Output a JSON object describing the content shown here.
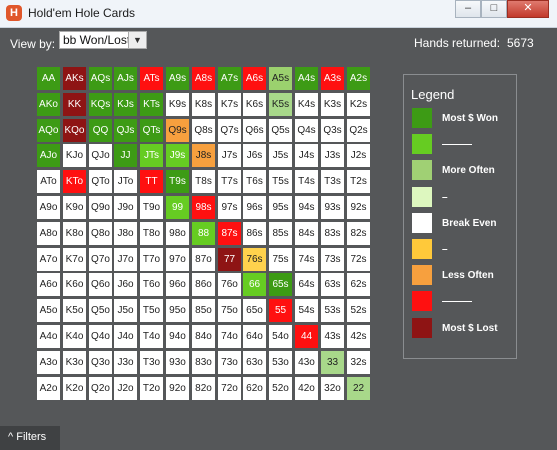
{
  "window": {
    "title": "Hold'em Hole Cards",
    "app_icon_glyph": "H",
    "controls": {
      "minimize": "–",
      "maximize": "□",
      "close": "✕"
    }
  },
  "toolbar": {
    "view_by_label": "View by:",
    "view_by_value": "bb Won/Lost",
    "hands_label": "Hands returned:",
    "hands_value": "5673"
  },
  "grid": {
    "rows": [
      [
        "AA",
        "AKs",
        "AQs",
        "AJs",
        "ATs",
        "A9s",
        "A8s",
        "A7s",
        "A6s",
        "A5s",
        "A4s",
        "A3s",
        "A2s"
      ],
      [
        "AKo",
        "KK",
        "KQs",
        "KJs",
        "KTs",
        "K9s",
        "K8s",
        "K7s",
        "K6s",
        "K5s",
        "K4s",
        "K3s",
        "K2s"
      ],
      [
        "AQo",
        "KQo",
        "QQ",
        "QJs",
        "QTs",
        "Q9s",
        "Q8s",
        "Q7s",
        "Q6s",
        "Q5s",
        "Q4s",
        "Q3s",
        "Q2s"
      ],
      [
        "AJo",
        "KJo",
        "QJo",
        "JJ",
        "JTs",
        "J9s",
        "J8s",
        "J7s",
        "J6s",
        "J5s",
        "J4s",
        "J3s",
        "J2s"
      ],
      [
        "ATo",
        "KTo",
        "QTo",
        "JTo",
        "TT",
        "T9s",
        "T8s",
        "T7s",
        "T6s",
        "T5s",
        "T4s",
        "T3s",
        "T2s"
      ],
      [
        "A9o",
        "K9o",
        "Q9o",
        "J9o",
        "T9o",
        "99",
        "98s",
        "97s",
        "96s",
        "95s",
        "94s",
        "93s",
        "92s"
      ],
      [
        "A8o",
        "K8o",
        "Q8o",
        "J8o",
        "T8o",
        "98o",
        "88",
        "87s",
        "86s",
        "85s",
        "84s",
        "83s",
        "82s"
      ],
      [
        "A7o",
        "K7o",
        "Q7o",
        "J7o",
        "T7o",
        "97o",
        "87o",
        "77",
        "76s",
        "75s",
        "74s",
        "73s",
        "72s"
      ],
      [
        "A6o",
        "K6o",
        "Q6o",
        "J6o",
        "T6o",
        "96o",
        "86o",
        "76o",
        "66",
        "65s",
        "64s",
        "63s",
        "62s"
      ],
      [
        "A5o",
        "K5o",
        "Q5o",
        "J5o",
        "T5o",
        "95o",
        "85o",
        "75o",
        "65o",
        "55",
        "54s",
        "53s",
        "52s"
      ],
      [
        "A4o",
        "K4o",
        "Q4o",
        "J4o",
        "T4o",
        "94o",
        "84o",
        "74o",
        "64o",
        "54o",
        "44",
        "43s",
        "42s"
      ],
      [
        "A3o",
        "K3o",
        "Q3o",
        "J3o",
        "T3o",
        "93o",
        "83o",
        "73o",
        "63o",
        "53o",
        "43o",
        "33",
        "32s"
      ],
      [
        "A2o",
        "K2o",
        "Q2o",
        "J2o",
        "T2o",
        "92o",
        "82o",
        "72o",
        "62o",
        "52o",
        "42o",
        "32o",
        "22"
      ]
    ],
    "levels": [
      [
        "won",
        "lost",
        "won",
        "won",
        "lostm",
        "won",
        "lostm",
        "won",
        "lostm",
        "lightwon",
        "won",
        "lostm",
        "won"
      ],
      [
        "won",
        "lost",
        "won",
        "won",
        "won",
        "even",
        "even",
        "even",
        "even",
        "oftenmore",
        "even",
        "even",
        "even"
      ],
      [
        "won",
        "lost",
        "won",
        "won",
        "won",
        "oftenless",
        "even",
        "even",
        "even",
        "even",
        "even",
        "even",
        "even"
      ],
      [
        "won",
        "even",
        "even",
        "won",
        "mwon",
        "mwon",
        "oftenless",
        "even",
        "even",
        "even",
        "even",
        "even",
        "even"
      ],
      [
        "even",
        "lostm",
        "even",
        "even",
        "lostm",
        "won",
        "even",
        "even",
        "even",
        "even",
        "even",
        "even",
        "even"
      ],
      [
        "even",
        "even",
        "even",
        "even",
        "even",
        "mwon",
        "lostm",
        "even",
        "even",
        "even",
        "even",
        "even",
        "even"
      ],
      [
        "even",
        "even",
        "even",
        "even",
        "even",
        "even",
        "mwon",
        "lostm",
        "even",
        "even",
        "even",
        "even",
        "even"
      ],
      [
        "even",
        "even",
        "even",
        "even",
        "even",
        "even",
        "even",
        "lost",
        "slight",
        "even",
        "even",
        "even",
        "even"
      ],
      [
        "even",
        "even",
        "even",
        "even",
        "even",
        "even",
        "even",
        "even",
        "mwon",
        "won",
        "even",
        "even",
        "even"
      ],
      [
        "even",
        "even",
        "even",
        "even",
        "even",
        "even",
        "even",
        "even",
        "even",
        "lostm",
        "even",
        "even",
        "even"
      ],
      [
        "even",
        "even",
        "even",
        "even",
        "even",
        "even",
        "even",
        "even",
        "even",
        "even",
        "lostm",
        "even",
        "even"
      ],
      [
        "even",
        "even",
        "even",
        "even",
        "even",
        "even",
        "even",
        "even",
        "even",
        "even",
        "even",
        "oftenmore",
        "even"
      ],
      [
        "even",
        "even",
        "even",
        "even",
        "even",
        "even",
        "even",
        "even",
        "even",
        "even",
        "even",
        "even",
        "oftenmore"
      ]
    ],
    "colors": {
      "won": "#3d9b15",
      "mwon": "#66cc22",
      "lightwon": "#9bd16e",
      "oftenmore": "#a8d88a",
      "even": "#ffffff",
      "slight": "#ffd24d",
      "oftenless": "#f7a03e",
      "lostm": "#ff1010",
      "lost": "#8e1414"
    }
  },
  "legend": {
    "title": "Legend",
    "items": [
      {
        "label": "Most $ Won",
        "color": "#3d9b15"
      },
      {
        "label": "———",
        "color": "#66cc22"
      },
      {
        "label": "More Often",
        "color": "#a0d074"
      },
      {
        "label": "–",
        "color": "#ddf7bf"
      },
      {
        "label": "Break Even",
        "color": "#ffffff"
      },
      {
        "label": "–",
        "color": "#ffc93a"
      },
      {
        "label": "Less Often",
        "color": "#f7a03e"
      },
      {
        "label": "———",
        "color": "#ff1010"
      },
      {
        "label": "Most $ Lost",
        "color": "#8e1414"
      }
    ]
  },
  "footer": {
    "filters_label": "Filters",
    "filters_icon": "^"
  }
}
